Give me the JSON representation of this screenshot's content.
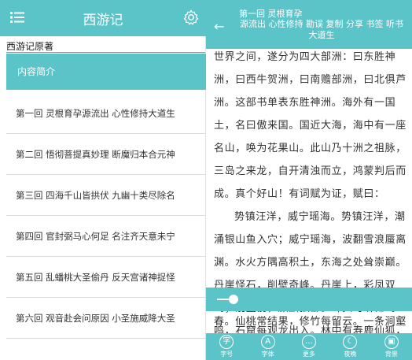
{
  "left": {
    "title": "西游记",
    "book_label": "西游记原著",
    "intro_label": "内容简介",
    "chapters": [
      "第一回 灵根育孕源流出 心性修持大道生",
      "第二回 悟彻菩提真妙理 断魔归本合元神",
      "第三回 四海千山皆拱伏 九幽十类尽除名",
      "第四回 官封弼马心何足 名注齐天意未宁",
      "第五回 乱蟠桃大圣偷丹 反天宫诸神捉怪",
      "第六回 观音赴会问原因 小圣施威降大圣"
    ],
    "icons": {
      "menu": "menu-icon",
      "settings": "gear-icon"
    }
  },
  "reader": {
    "chapter_title": "第一回 灵根育孕",
    "actions_text": "源流出 心性修持 勘误 复制 分享 书签 听书 大道生",
    "actions": [
      "源流出 心性修持",
      "勘误",
      "复制",
      "分享",
      "书签",
      "听书",
      "大道生"
    ],
    "paragraphs": [
      "世界之间，遂分为四大部洲：曰东胜神洲，曰西牛贺洲，曰南赡部洲，曰北俱芦洲。这部书单表东胜神洲。海外有一国土，名曰傲来国。国近大海，海中有一座名山，唤为花果山。此山乃十洲之祖脉，三岛之来龙，自开清浊而立，鸿蒙判后而成。真个好山！有词赋为证，赋曰：",
      "势镇汪洋，威宁瑶海。势镇汪洋，潮涌银山鱼入穴；威宁瑶海，波翻雪浪蜃离渊。水火方隅高积土，东海之处耸崇巅。丹崖怪石，削壁奇峰。丹崖上，彩凤双鸣；削壁前，麒麟独卧。峰头时听锦鸡鸣，石窟每观龙出入。林中有寿鹿仙狐，树上"
    ],
    "bottom_line": "春。仙桃常结果，修竹每留云。一条涧壑",
    "progress_percent": 9,
    "toolbar": [
      {
        "label": "字号",
        "icon": "font-size-icon",
        "glyph": "字"
      },
      {
        "label": "字体",
        "icon": "font-family-icon",
        "glyph": "A"
      },
      {
        "label": "更多",
        "icon": "more-icon",
        "glyph": "…"
      },
      {
        "label": "夜晚",
        "icon": "night-mode-icon",
        "glyph": "☾"
      },
      {
        "label": "背景",
        "icon": "background-icon",
        "glyph": "▣"
      }
    ]
  },
  "colors": {
    "accent": "#5bc4c9",
    "text": "#333333",
    "divider": "#dcdcdc"
  }
}
